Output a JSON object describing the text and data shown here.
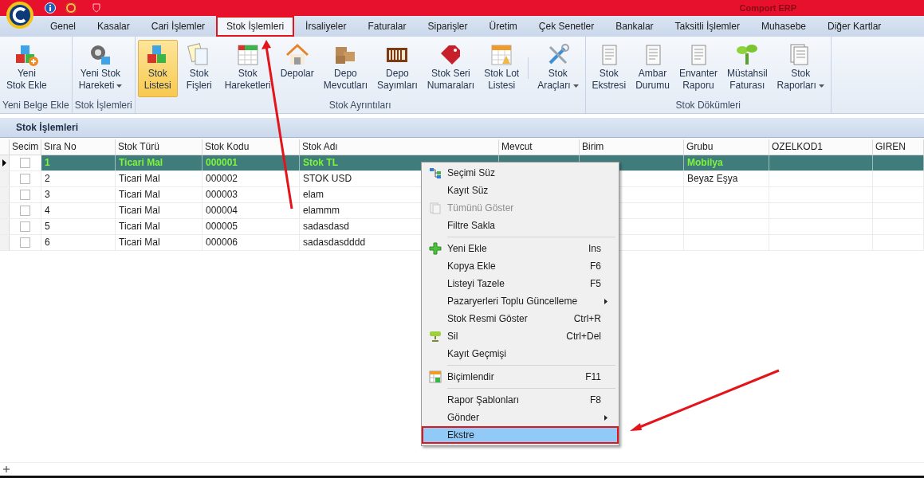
{
  "window": {
    "title": "Comport ERP"
  },
  "tabs": [
    {
      "label": "Genel",
      "selected": false,
      "annotated": false
    },
    {
      "label": "Kasalar",
      "selected": false,
      "annotated": false
    },
    {
      "label": "Cari İşlemler",
      "selected": false,
      "annotated": false
    },
    {
      "label": "Stok İşlemleri",
      "selected": true,
      "annotated": true
    },
    {
      "label": "İrsaliyeler",
      "selected": false,
      "annotated": false
    },
    {
      "label": "Faturalar",
      "selected": false,
      "annotated": false
    },
    {
      "label": "Siparişler",
      "selected": false,
      "annotated": false
    },
    {
      "label": "Üretim",
      "selected": false,
      "annotated": false
    },
    {
      "label": "Çek Senetler",
      "selected": false,
      "annotated": false
    },
    {
      "label": "Bankalar",
      "selected": false,
      "annotated": false
    },
    {
      "label": "Taksitli İşlemler",
      "selected": false,
      "annotated": false
    },
    {
      "label": "Muhasebe",
      "selected": false,
      "annotated": false
    },
    {
      "label": "Diğer Kartlar",
      "selected": false,
      "annotated": false
    }
  ],
  "ribbon": [
    {
      "group": "Yeni Belge Ekle",
      "buttons": [
        {
          "label": "Yeni\nStok Ekle",
          "selected": false,
          "dropdown": false
        }
      ]
    },
    {
      "group": "Stok İşlemleri",
      "buttons": [
        {
          "label": "Yeni Stok\nHareketi",
          "selected": false,
          "dropdown": true
        }
      ]
    },
    {
      "group": "Stok Ayrıntıları",
      "buttons": [
        {
          "label": "Stok\nListesi",
          "selected": true,
          "dropdown": false
        },
        {
          "label": "Stok\nFişleri",
          "selected": false,
          "dropdown": false
        },
        {
          "label": "Stok\nHareketleri",
          "selected": false,
          "dropdown": false
        },
        {
          "label": "Depolar",
          "selected": false,
          "dropdown": false
        },
        {
          "label": "Depo\nMevcutları",
          "selected": false,
          "dropdown": false
        },
        {
          "label": "Depo\nSayımları",
          "selected": false,
          "dropdown": false
        },
        {
          "label": "Stok Seri\nNumaraları",
          "selected": false,
          "dropdown": false
        },
        {
          "label": "Stok Lot\nListesi",
          "selected": false,
          "dropdown": false
        },
        {
          "label": "Stok\nAraçları",
          "selected": false,
          "dropdown": true
        }
      ]
    },
    {
      "group": "Stok Dökümleri",
      "buttons": [
        {
          "label": "Stok\nEkstresi",
          "selected": false,
          "dropdown": false
        },
        {
          "label": "Ambar\nDurumu",
          "selected": false,
          "dropdown": false
        },
        {
          "label": "Envanter\nRaporu",
          "selected": false,
          "dropdown": false
        },
        {
          "label": "Müstahsil\nFaturası",
          "selected": false,
          "dropdown": false
        },
        {
          "label": "Stok\nRaporları",
          "selected": false,
          "dropdown": true
        }
      ]
    }
  ],
  "panel": {
    "title": "Stok İşlemleri"
  },
  "table": {
    "check_column": "Secim",
    "columns": [
      "Sıra No",
      "Stok Türü",
      "Stok Kodu",
      "Stok Adı",
      "Mevcut",
      "Birim",
      "Grubu",
      "OZELKOD1",
      "GIREN"
    ],
    "rows": [
      {
        "selected": true,
        "checked": false,
        "cells": [
          "1",
          "Ticari Mal",
          "000001",
          "Stok TL",
          "",
          "",
          "Mobilya",
          "",
          ""
        ]
      },
      {
        "selected": false,
        "checked": false,
        "cells": [
          "2",
          "Ticari Mal",
          "000002",
          "STOK USD",
          "",
          "",
          "Beyaz Eşya",
          "",
          ""
        ]
      },
      {
        "selected": false,
        "checked": false,
        "cells": [
          "3",
          "Ticari Mal",
          "000003",
          "elam",
          "",
          "",
          "",
          "",
          ""
        ]
      },
      {
        "selected": false,
        "checked": false,
        "cells": [
          "4",
          "Ticari Mal",
          "000004",
          "elammm",
          "",
          "",
          "",
          "",
          ""
        ]
      },
      {
        "selected": false,
        "checked": false,
        "cells": [
          "5",
          "Ticari Mal",
          "000005",
          "sadasdasd",
          "",
          "",
          "",
          "",
          ""
        ]
      },
      {
        "selected": false,
        "checked": false,
        "cells": [
          "6",
          "Ticari Mal",
          "000006",
          "sadasdasdddd",
          "",
          "",
          "",
          "",
          ""
        ]
      }
    ]
  },
  "context_menu": [
    {
      "kind": "item",
      "label": "Seçimi Süz",
      "disabled": false,
      "highlighted": false,
      "submenu": false
    },
    {
      "kind": "item",
      "label": "Kayıt Süz",
      "disabled": false,
      "highlighted": false,
      "submenu": false
    },
    {
      "kind": "item",
      "label": "Tümünü Göster",
      "disabled": true,
      "highlighted": false,
      "submenu": false
    },
    {
      "kind": "item",
      "label": "Filtre Sakla",
      "disabled": false,
      "highlighted": false,
      "submenu": false
    },
    {
      "kind": "separator"
    },
    {
      "kind": "item",
      "label": "Yeni Ekle",
      "shortcut": "Ins",
      "disabled": false,
      "highlighted": false,
      "submenu": false
    },
    {
      "kind": "item",
      "label": "Kopya Ekle",
      "shortcut": "F6",
      "disabled": false,
      "highlighted": false,
      "submenu": false
    },
    {
      "kind": "item",
      "label": "Listeyi Tazele",
      "shortcut": "F5",
      "disabled": false,
      "highlighted": false,
      "submenu": false
    },
    {
      "kind": "item",
      "label": "Pazaryerleri Toplu Güncelleme",
      "disabled": false,
      "highlighted": false,
      "submenu": true
    },
    {
      "kind": "item",
      "label": "Stok Resmi Göster",
      "shortcut": "Ctrl+R",
      "disabled": false,
      "highlighted": false,
      "submenu": false
    },
    {
      "kind": "item",
      "label": "Sil",
      "shortcut": "Ctrl+Del",
      "disabled": false,
      "highlighted": false,
      "submenu": false
    },
    {
      "kind": "item",
      "label": "Kayıt Geçmişi",
      "disabled": false,
      "highlighted": false,
      "submenu": false
    },
    {
      "kind": "separator"
    },
    {
      "kind": "item",
      "label": "Biçimlendir",
      "shortcut": "F11",
      "disabled": false,
      "highlighted": false,
      "submenu": false
    },
    {
      "kind": "separator"
    },
    {
      "kind": "item",
      "label": "Rapor Şablonları",
      "shortcut": "F8",
      "disabled": false,
      "highlighted": false,
      "submenu": false
    },
    {
      "kind": "item",
      "label": "Gönder",
      "disabled": false,
      "highlighted": false,
      "submenu": true
    },
    {
      "kind": "item",
      "label": "Ekstre",
      "disabled": false,
      "highlighted": true,
      "submenu": false,
      "annotated": true
    }
  ]
}
